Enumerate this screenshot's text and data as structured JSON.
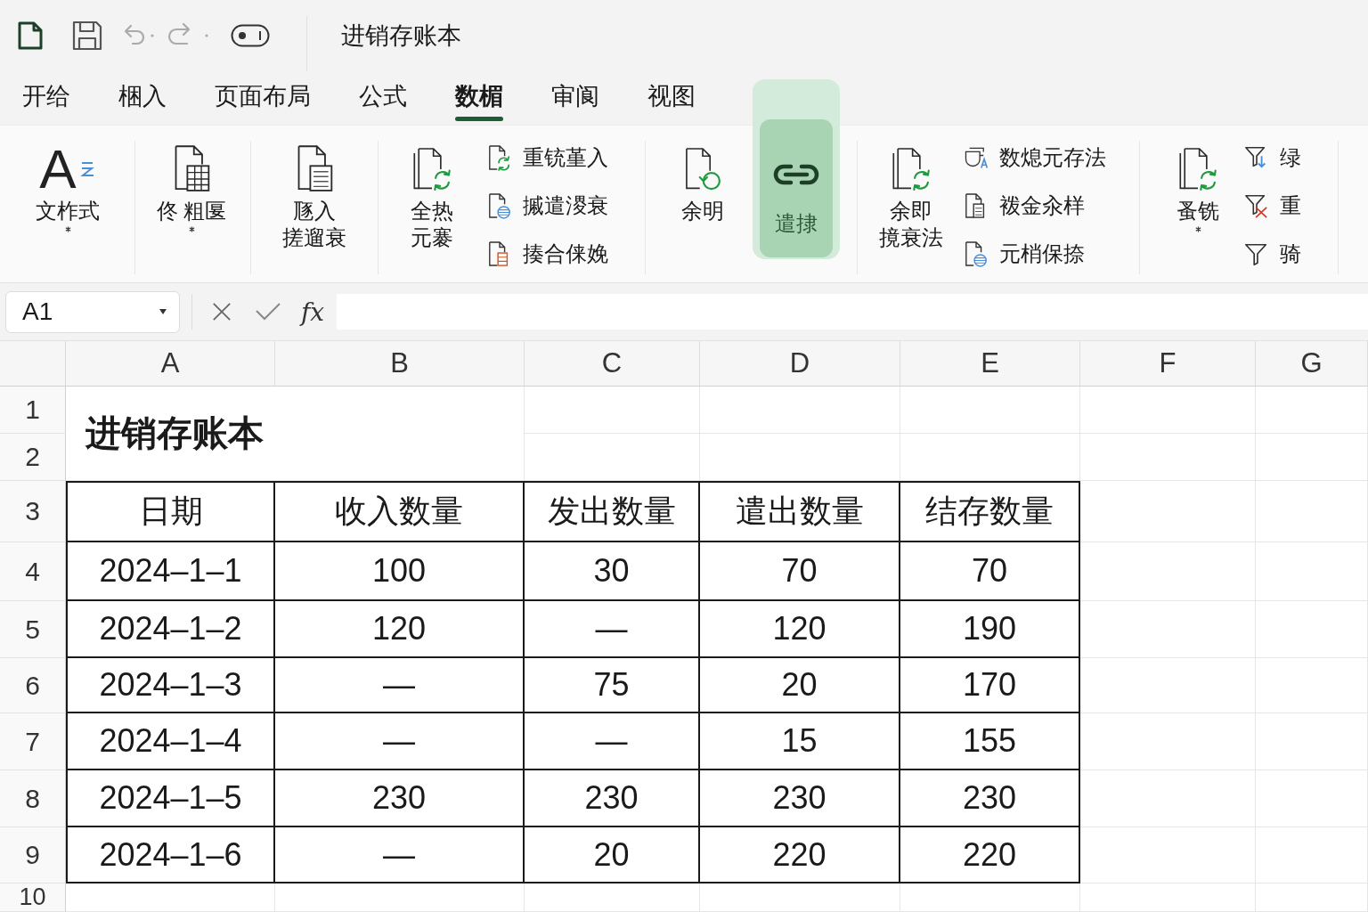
{
  "title_bar": {
    "document_title": "进销存账本"
  },
  "tabs": [
    {
      "label": "开给",
      "selected": false
    },
    {
      "label": "梱入",
      "selected": false
    },
    {
      "label": "页面布局",
      "selected": false
    },
    {
      "label": "公式",
      "selected": false
    },
    {
      "label": "数楣",
      "selected": true
    },
    {
      "label": "审阆",
      "selected": false
    },
    {
      "label": "视图",
      "selected": false
    }
  ],
  "ribbon": [
    {
      "large": [
        {
          "lines": [
            "文柞式"
          ],
          "glyph": "A",
          "dropdown": true,
          "highlighted": false
        }
      ]
    },
    {
      "large": [
        {
          "lines": [
            "佟 粗匽"
          ],
          "dropdown": true,
          "highlighted": false
        }
      ]
    },
    {
      "large": [
        {
          "lines": [
            "豗入",
            "搓遛衰"
          ],
          "dropdown": false,
          "highlighted": false
        }
      ]
    },
    {
      "large": [
        {
          "lines": [
            "全热",
            "元褰"
          ],
          "dropdown": false,
          "highlighted": false
        }
      ],
      "small": [
        {
          "label": "重铳堇入"
        },
        {
          "label": "摵遣溭衰"
        },
        {
          "label": "揍合俫娩"
        }
      ]
    },
    {
      "large": [
        {
          "lines": [
            "余明"
          ],
          "dropdown": false,
          "highlighted": false
        },
        {
          "lines": [
            "遣捸"
          ],
          "dropdown": false,
          "highlighted": true
        }
      ]
    },
    {
      "large": [
        {
          "lines": [
            "余即",
            "摬衰法"
          ],
          "dropdown": false,
          "highlighted": false
        }
      ],
      "small": [
        {
          "label": "数熄元存法"
        },
        {
          "label": "袯金汆样"
        },
        {
          "label": "元梢保捺"
        }
      ]
    },
    {
      "large": [
        {
          "lines": [
            "蚤铣"
          ],
          "dropdown": true,
          "highlighted": false
        }
      ],
      "small": [
        {
          "label": "绿"
        },
        {
          "label": "重"
        },
        {
          "label": "骑"
        }
      ]
    }
  ],
  "formula_bar": {
    "cell_reference": "A1",
    "function_symbol": "fx"
  },
  "sheet": {
    "columns": [
      "A",
      "B",
      "C",
      "D",
      "E",
      "F",
      "G"
    ],
    "rows": [
      "1",
      "2",
      "3",
      "4",
      "5",
      "6",
      "7",
      "8",
      "9",
      "10"
    ],
    "title": "进销存账本",
    "table": {
      "header": [
        "日期",
        "收入数量",
        "发出数量",
        "遣出数量",
        "结存数量"
      ],
      "rows": [
        [
          "2024–1–1",
          "100",
          "30",
          "70",
          "70"
        ],
        [
          "2024–1–2",
          "120",
          "—",
          "120",
          "190"
        ],
        [
          "2024–1–3",
          "—",
          "75",
          "20",
          "170"
        ],
        [
          "2024–1–4",
          "—",
          "—",
          "15",
          "155"
        ],
        [
          "2024–1–5",
          "230",
          "230",
          "230",
          "230"
        ],
        [
          "2024–1–6",
          "—",
          "20",
          "220",
          "220"
        ]
      ]
    }
  }
}
